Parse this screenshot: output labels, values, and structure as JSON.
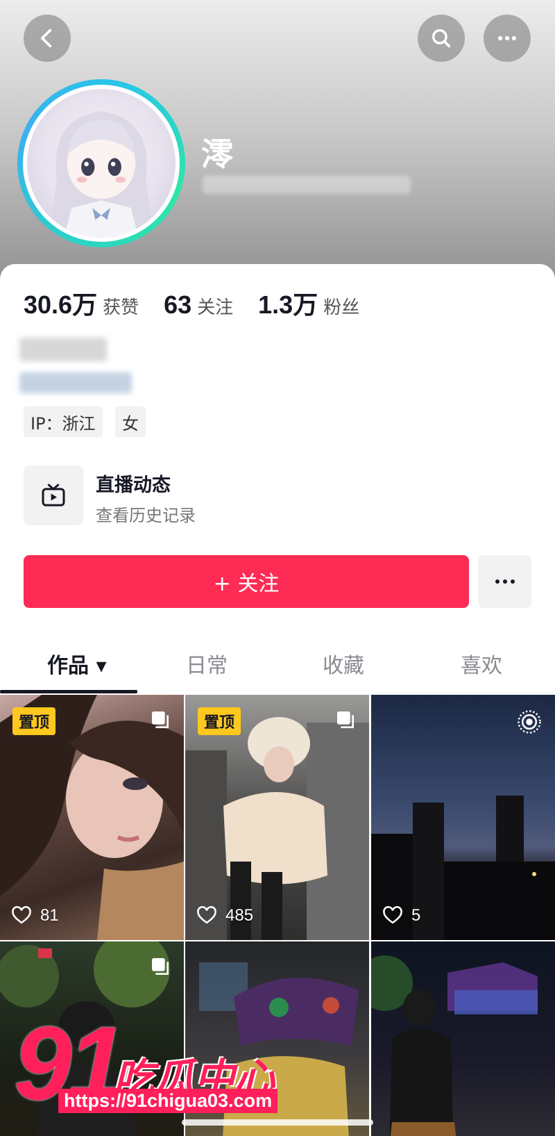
{
  "profile": {
    "name": "澪"
  },
  "stats": [
    {
      "value": "30.6万",
      "label": "获赞"
    },
    {
      "value": "63",
      "label": "关注"
    },
    {
      "value": "1.3万",
      "label": "粉丝"
    }
  ],
  "tags": [
    "IP：浙江",
    "女"
  ],
  "live": {
    "title": "直播动态",
    "subtitle": "查看历史记录"
  },
  "follow_button": "+ 关注",
  "tabs": [
    {
      "label": "作品 ▾",
      "active": true
    },
    {
      "label": "日常",
      "active": false
    },
    {
      "label": "收藏",
      "active": false
    },
    {
      "label": "喜欢",
      "active": false
    }
  ],
  "pinned_label": "置顶",
  "posts": [
    {
      "likes": "81"
    },
    {
      "likes": "485"
    },
    {
      "likes": "5"
    }
  ],
  "watermark": {
    "number": "91",
    "text": "吃瓜中心",
    "url": "https://91chigua03.com"
  },
  "colors": {
    "accent": "#fe2c55",
    "pin": "#ffc81e"
  }
}
